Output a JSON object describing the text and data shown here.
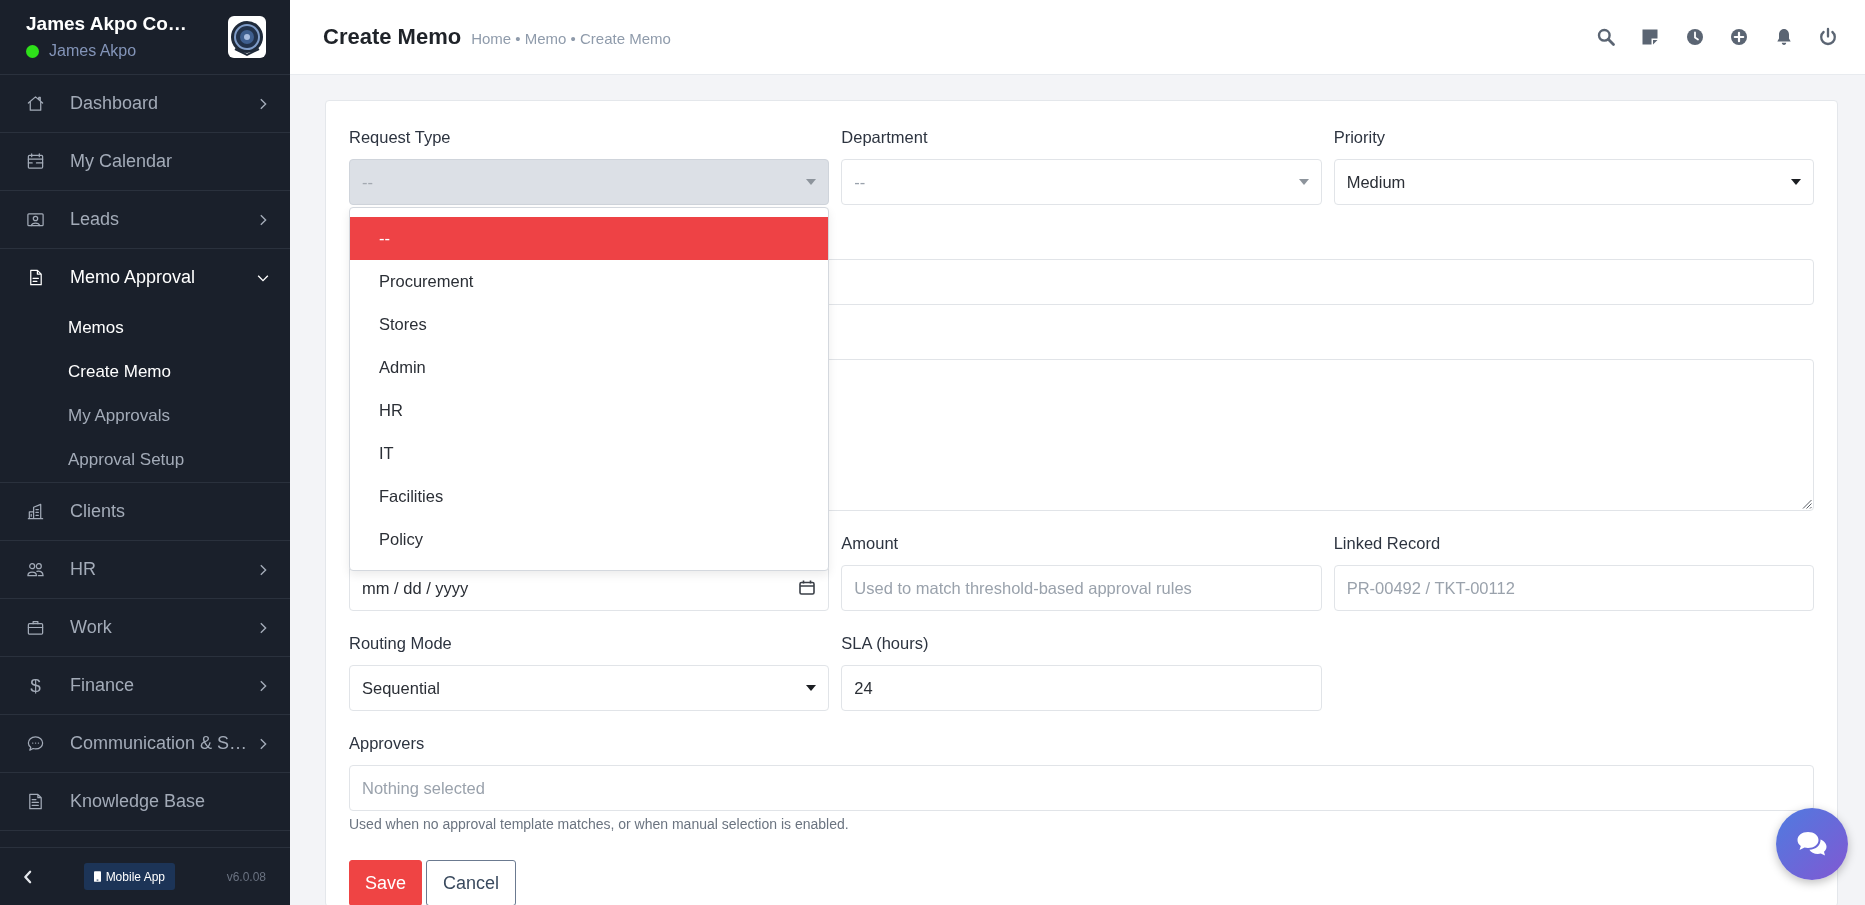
{
  "sidebar": {
    "brand": {
      "title": "James Akpo Co…",
      "user": "James Akpo",
      "online": true
    },
    "menu": [
      {
        "label": "Dashboard",
        "kind": "group",
        "expanded": false,
        "selected": false
      },
      {
        "label": "My Calendar",
        "kind": "link",
        "selected": false
      },
      {
        "label": "Leads",
        "kind": "group",
        "expanded": false,
        "selected": false
      },
      {
        "label": "Memo Approval",
        "kind": "group",
        "expanded": true,
        "selected": true,
        "children": [
          {
            "label": "Memos",
            "selected": true
          },
          {
            "label": "Create Memo",
            "selected": true
          },
          {
            "label": "My Approvals",
            "selected": false
          },
          {
            "label": "Approval Setup",
            "selected": false
          }
        ]
      },
      {
        "label": "Clients",
        "kind": "link",
        "selected": false
      },
      {
        "label": "HR",
        "kind": "group",
        "expanded": false,
        "selected": false
      },
      {
        "label": "Work",
        "kind": "group",
        "expanded": false,
        "selected": false
      },
      {
        "label": "Finance",
        "kind": "group",
        "expanded": false,
        "selected": false,
        "glyph": "$"
      },
      {
        "label": "Communication & S…",
        "kind": "group",
        "expanded": false,
        "selected": false
      },
      {
        "label": "Knowledge Base",
        "kind": "link",
        "selected": false
      }
    ],
    "footer": {
      "button": "Mobile App",
      "version": "v6.0.08"
    }
  },
  "header": {
    "title": "Create Memo",
    "breadcrumb": "Home • Memo • Create Memo"
  },
  "form": {
    "rows": [
      {
        "fields": [
          {
            "label": "Request Type",
            "kind": "picker",
            "placeholder": "--",
            "open": true,
            "options": [
              {
                "label": "--",
                "selected": true
              },
              {
                "label": "Procurement",
                "selected": false
              },
              {
                "label": "Stores",
                "selected": false
              },
              {
                "label": "Admin",
                "selected": false
              },
              {
                "label": "HR",
                "selected": false
              },
              {
                "label": "IT",
                "selected": false
              },
              {
                "label": "Facilities",
                "selected": false
              },
              {
                "label": "Policy",
                "selected": false
              }
            ]
          },
          {
            "label": "Department",
            "kind": "picker",
            "placeholder": "--",
            "open": false
          },
          {
            "label": "Priority",
            "kind": "select",
            "value": "Medium"
          }
        ]
      },
      {
        "fields": [
          {
            "kind": "text"
          }
        ]
      },
      {
        "fields": [
          {
            "kind": "textarea"
          }
        ]
      },
      {
        "fields": [
          {
            "kind": "date",
            "placeholder": "mm / dd / yyyy"
          },
          {
            "label": "Amount",
            "kind": "text",
            "placeholder": "Used to match threshold-based approval rules"
          },
          {
            "label": "Linked Record",
            "kind": "text",
            "placeholder": "PR-00492 / TKT-00112"
          }
        ]
      },
      {
        "fields": [
          {
            "label": "Routing Mode",
            "kind": "select",
            "value": "Sequential"
          },
          {
            "label": "SLA (hours)",
            "kind": "text",
            "value": "24"
          }
        ]
      },
      {
        "fields": [
          {
            "label": "Approvers",
            "kind": "multiselect",
            "placeholder": "Nothing selected",
            "help": "Used when no approval template matches, or when manual selection is enabled."
          }
        ]
      }
    ],
    "buttons": [
      {
        "label": "Save",
        "kind": "primary"
      },
      {
        "label": "Cancel",
        "kind": "secondary"
      }
    ]
  }
}
